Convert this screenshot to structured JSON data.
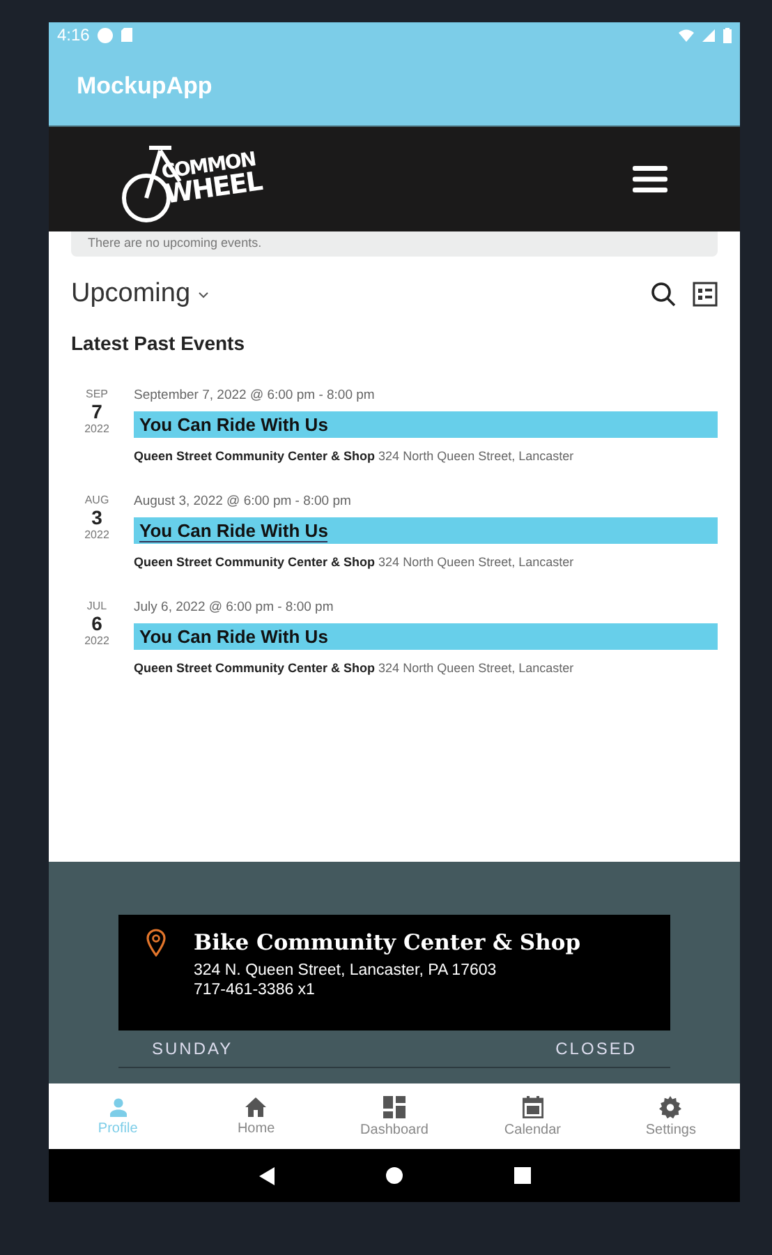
{
  "status_bar": {
    "time": "4:16"
  },
  "app_bar": {
    "title": "MockupApp"
  },
  "site_header": {
    "logo_lines": [
      "COMMON",
      "WHEEL"
    ]
  },
  "notice": "There are no upcoming events.",
  "view_selector": {
    "label": "Upcoming"
  },
  "section_title": "Latest Past Events",
  "events": [
    {
      "month": "SEP",
      "day": "7",
      "year": "2022",
      "datetime": "September 7, 2022 @ 6:00 pm - 8:00 pm",
      "title": "You Can Ride With Us",
      "venue": "Queen Street Community Center & Shop",
      "address": "324 North Queen Street, Lancaster",
      "underlined": false
    },
    {
      "month": "AUG",
      "day": "3",
      "year": "2022",
      "datetime": "August 3, 2022 @ 6:00 pm - 8:00 pm",
      "title": "You Can Ride With Us",
      "venue": "Queen Street Community Center & Shop",
      "address": "324 North Queen Street, Lancaster",
      "underlined": true
    },
    {
      "month": "JUL",
      "day": "6",
      "year": "2022",
      "datetime": "July 6, 2022 @ 6:00 pm - 8:00 pm",
      "title": "You Can Ride With Us",
      "venue": "Queen Street Community Center & Shop",
      "address": "324 North Queen Street, Lancaster",
      "underlined": false
    }
  ],
  "location_card": {
    "name": "Bike Community Center & Shop",
    "address": "324 N. Queen Street, Lancaster, PA 17603",
    "phone": "717-461-3386 x1"
  },
  "hours": [
    {
      "day": "SUNDAY",
      "status": "CLOSED"
    }
  ],
  "bottom_nav": [
    {
      "kind": "profile",
      "label": "Profile",
      "selected": true
    },
    {
      "kind": "home",
      "label": "Home",
      "selected": false
    },
    {
      "kind": "dashboard",
      "label": "Dashboard",
      "selected": false
    },
    {
      "kind": "calendar",
      "label": "Calendar",
      "selected": false
    },
    {
      "kind": "settings",
      "label": "Settings",
      "selected": false
    }
  ]
}
